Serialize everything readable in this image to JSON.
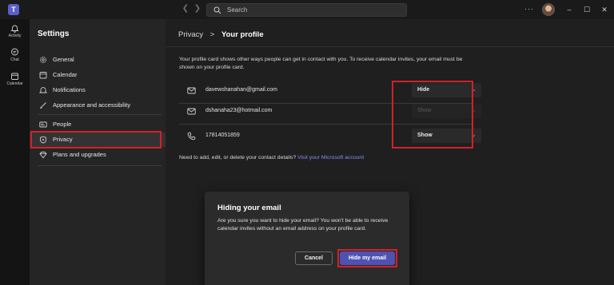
{
  "titlebar": {
    "search_placeholder": "Search",
    "more_label": "···",
    "minimize_label": "–",
    "maximize_label": "☐",
    "close_label": "✕"
  },
  "rail": {
    "items": [
      {
        "label": "Activity",
        "icon": "bell-icon"
      },
      {
        "label": "Chat",
        "icon": "chat-icon"
      },
      {
        "label": "Calendar",
        "icon": "calendar-icon"
      }
    ]
  },
  "sidebar": {
    "title": "Settings",
    "items": [
      {
        "label": "General",
        "icon": "gear-icon"
      },
      {
        "label": "Calendar",
        "icon": "calendar-icon"
      },
      {
        "label": "Notifications",
        "icon": "bell-icon"
      },
      {
        "label": "Appearance and accessibility",
        "icon": "brush-icon"
      },
      {
        "label": "People",
        "icon": "id-card-icon"
      },
      {
        "label": "Privacy",
        "icon": "shield-icon"
      },
      {
        "label": "Plans and upgrades",
        "icon": "diamond-icon"
      }
    ],
    "selected": "Privacy"
  },
  "main": {
    "breadcrumb": {
      "parent": "Privacy",
      "separator": ">",
      "current": "Your profile"
    },
    "description": "Your profile card shows other ways people can get in contact with you. To receive calendar invites, your email must be shown on your profile card.",
    "contacts": [
      {
        "value": "davewshanahan@gmail.com",
        "icon": "mail-icon",
        "visibility": "Hide",
        "enabled": true
      },
      {
        "value": "dshanaha23@hotmail.com",
        "icon": "mail-icon",
        "visibility": "Show",
        "enabled": false
      },
      {
        "value": "17814051859",
        "icon": "phone-icon",
        "visibility": "Show",
        "enabled": true
      }
    ],
    "help_text": "Need to add, edit, or delete your contact details?",
    "help_link": "Visit your Microsoft account"
  },
  "dialog": {
    "title": "Hiding your email",
    "body": "Are you sure you want to hide your email? You won't be able to receive calendar invites without an email address on your profile card.",
    "cancel_label": "Cancel",
    "confirm_label": "Hide my email"
  },
  "colors": {
    "accent": "#5b5fc7",
    "primary_button": "#4f52b2",
    "highlight": "#d3202a",
    "link": "#8b8ef0"
  }
}
